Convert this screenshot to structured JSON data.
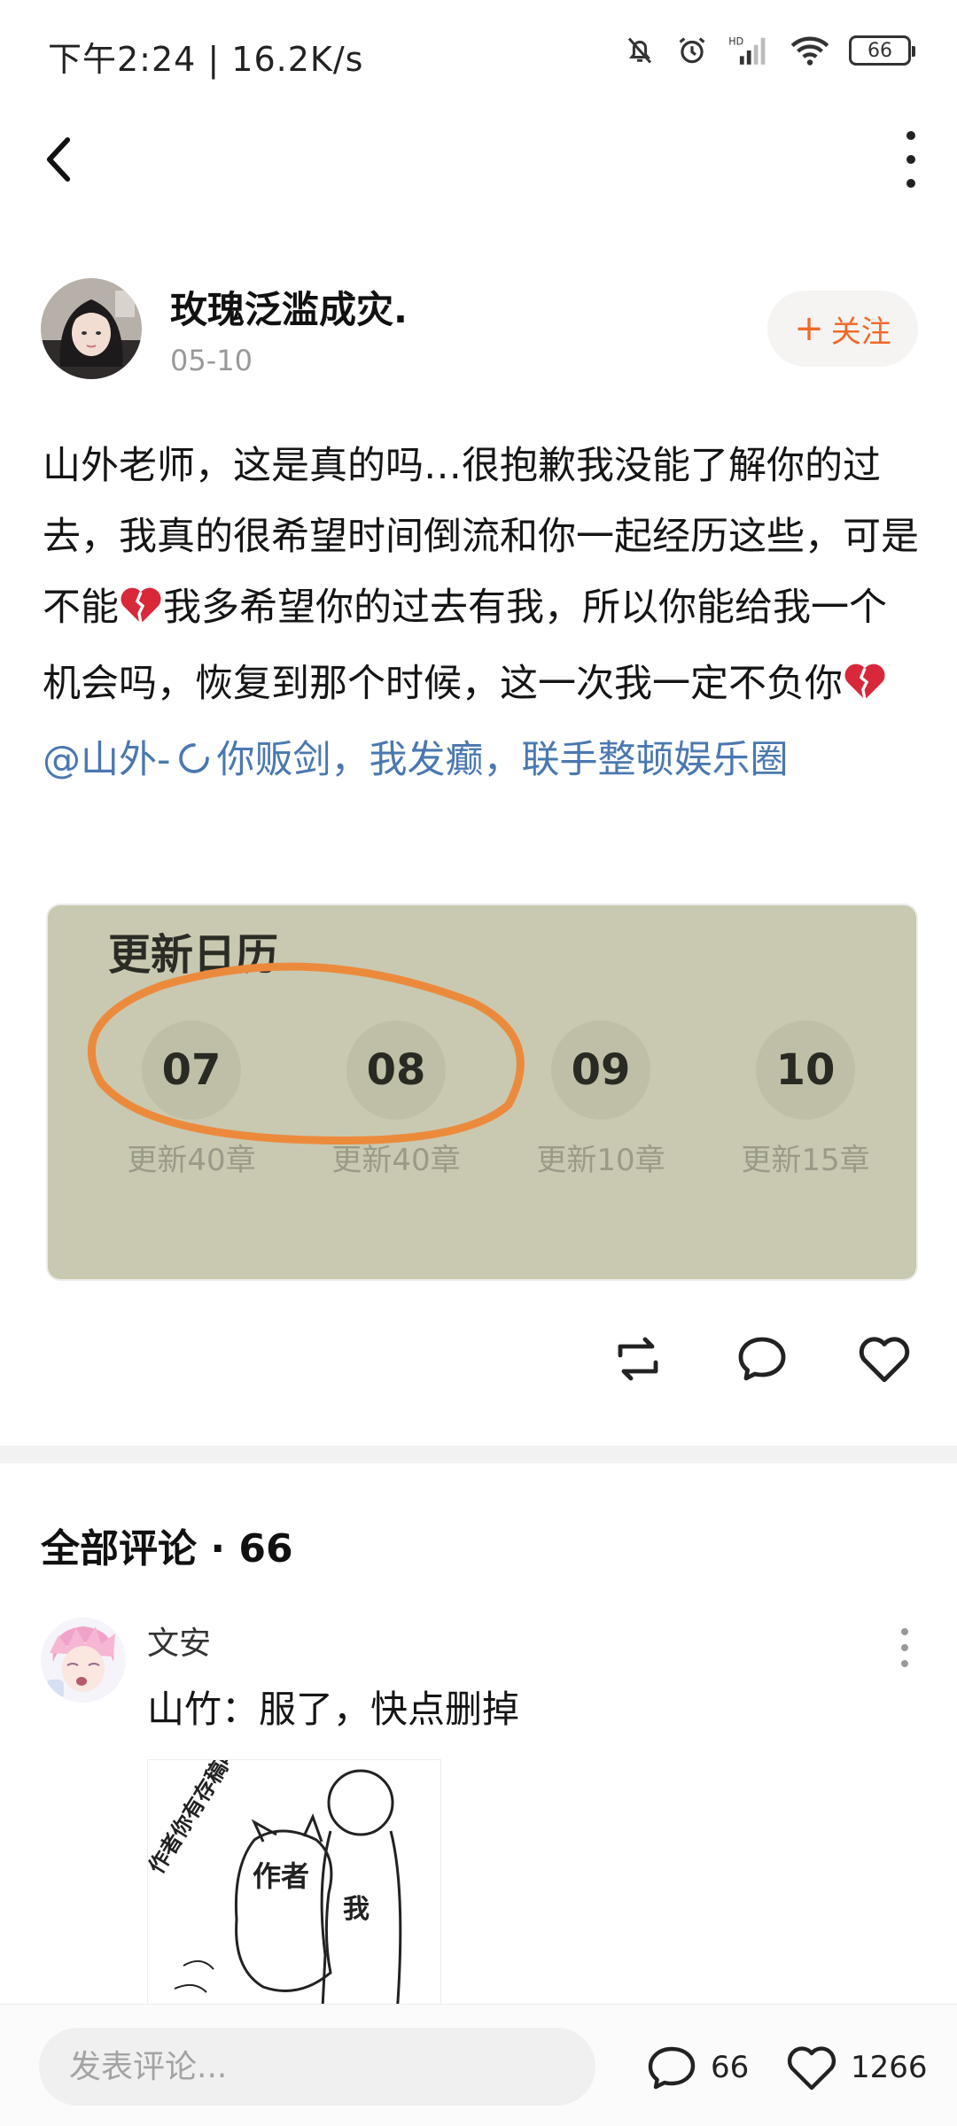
{
  "status_bar": {
    "time": "下午2:24 | 16.2K/s",
    "battery": "66",
    "icons": [
      "bell-mute-icon",
      "alarm-icon",
      "signal-hd-icon",
      "wifi-icon",
      "battery-icon"
    ]
  },
  "nav": {
    "back_icon": "chevron-left-icon",
    "more_icon": "vertical-dots-icon"
  },
  "post": {
    "author_name": "玫瑰泛滥成灾.",
    "date": "05-10",
    "follow_plus": "+",
    "follow_label": "关注",
    "text_1": "山外老师，这是真的吗…很抱歉我没能了解你的过去，我真的很希望时间倒流和你一起经历这些，可是不能",
    "text_2": "我多希望你的过去有我，所以你能给我一个机会吗，恢复到那个时候，这一次我一定不负你",
    "mention": "@山外-",
    "link_text": "你贩剑，我发癫，联手整顿娱乐圈",
    "emoji_icon": "broken-heart-icon"
  },
  "image_card": {
    "title": "更新日历",
    "days": [
      {
        "day": "07",
        "label": "更新40章"
      },
      {
        "day": "08",
        "label": "更新40章"
      },
      {
        "day": "09",
        "label": "更新10章"
      },
      {
        "day": "10",
        "label": "更新15章"
      }
    ]
  },
  "actions": {
    "icons": [
      "repost-icon",
      "comment-icon",
      "like-icon"
    ]
  },
  "comments": {
    "title": "全部评论 · 66",
    "items": [
      {
        "user": "文安",
        "text": "山竹：服了，快点删掉",
        "image_text_top": "作者你有存稿吗",
        "image_text_left": "作者",
        "image_text_right": "我"
      }
    ]
  },
  "bottom_bar": {
    "input_placeholder": "发表评论...",
    "comment_count": "66",
    "like_count": "1266"
  },
  "colors": {
    "accent_orange": "#f06a2a",
    "link_blue": "#4a78b0",
    "card_bg": "#c9c9b1"
  }
}
